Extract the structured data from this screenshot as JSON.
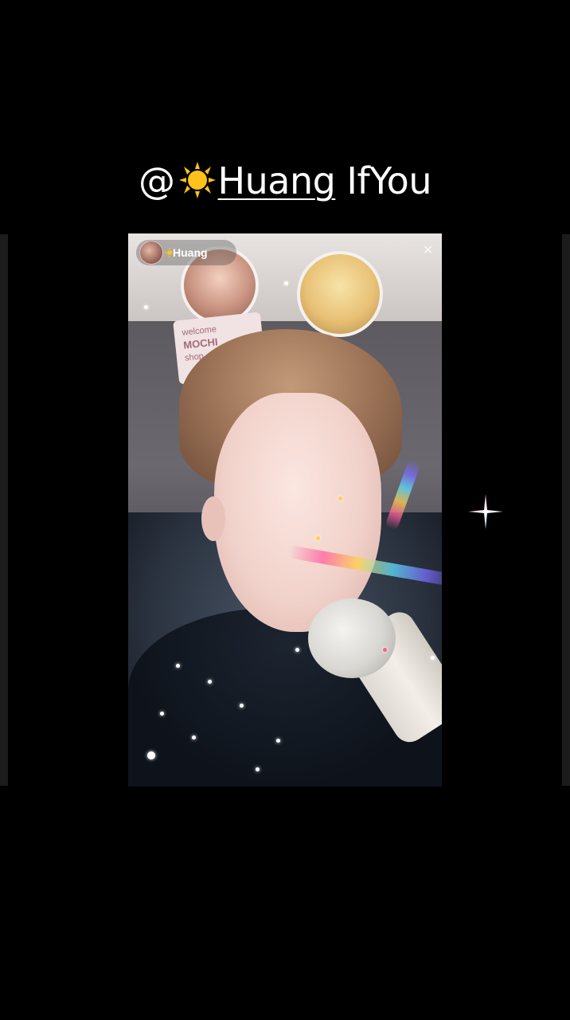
{
  "caption": {
    "at": "@",
    "sun_icon": "sun-emoji",
    "mention": "Huang",
    "suffix": " IfYou"
  },
  "live": {
    "host_name": "Huang",
    "host_icon": "sun-emoji",
    "close_icon": "close-icon"
  },
  "video": {
    "sign_lines": [
      "welcome",
      "MOCHI",
      "shop"
    ]
  },
  "colors": {
    "background": "#000000",
    "caption_text": "#ffffff",
    "sun": "#ffc21a"
  }
}
